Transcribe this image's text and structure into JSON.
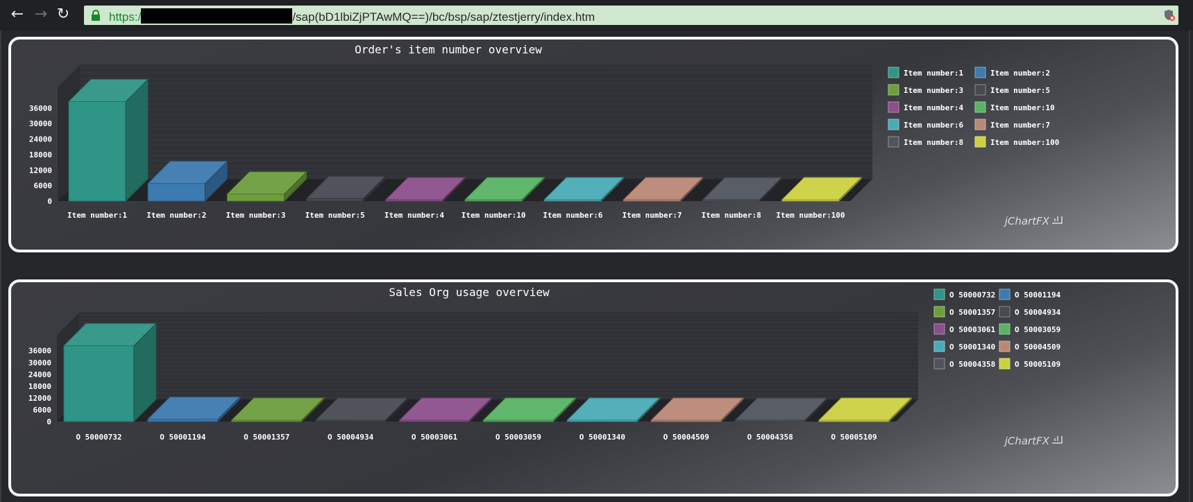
{
  "browser": {
    "url_scheme": "https:/",
    "url_path": "/sap(bD1lbiZjPTAwMQ==)/bc/bsp/sap/ztestjerry/index.htm",
    "back_icon": "arrow-left-icon",
    "forward_icon": "arrow-right-icon",
    "reload_icon": "reload-icon",
    "secure_icon": "lock-icon",
    "extension_icon": "shield-icon"
  },
  "colors": {
    "teal": "#2f9586",
    "blue": "#3d7ab0",
    "green": "#6d9e3d",
    "dark": "#474a52",
    "purple": "#8b4f8c",
    "lightgreen": "#59b363",
    "cyan": "#4aabb6",
    "salmon": "#b98876",
    "slate": "#4f545e",
    "yellow": "#ccd142"
  },
  "charts": [
    {
      "brand": "jChartFX",
      "chart_data": {
        "type": "bar",
        "title": "Order's item number overview",
        "categories": [
          "Item number:1",
          "Item number:2",
          "Item number:3",
          "Item number:5",
          "Item number:4",
          "Item number:10",
          "Item number:6",
          "Item number:7",
          "Item number:8",
          "Item number:100"
        ],
        "values": [
          38500,
          6800,
          2700,
          1000,
          200,
          150,
          100,
          80,
          60,
          30
        ],
        "colors": [
          "#2f9586",
          "#3d7ab0",
          "#6d9e3d",
          "#474a52",
          "#8b4f8c",
          "#59b363",
          "#4aabb6",
          "#b98876",
          "#4f545e",
          "#ccd142"
        ],
        "yticks": [
          "0",
          "6000",
          "12000",
          "18000",
          "24000",
          "30000",
          "36000"
        ],
        "ylim": [
          0,
          44000
        ],
        "xlabel": "",
        "ylabel": "",
        "legend": [
          "Item number:1",
          "Item number:2",
          "Item number:3",
          "Item number:5",
          "Item number:4",
          "Item number:10",
          "Item number:6",
          "Item number:7",
          "Item number:8",
          "Item number:100"
        ],
        "legend_position": "right",
        "grid": true
      }
    },
    {
      "brand": "jChartFX",
      "chart_data": {
        "type": "bar",
        "title": "Sales Org usage overview",
        "categories": [
          "O 50000732",
          "O 50001194",
          "O 50001357",
          "O 50004934",
          "O 50003061",
          "O 50003059",
          "O 50001340",
          "O 50004509",
          "O 50004358",
          "O 50005109"
        ],
        "values": [
          38500,
          1200,
          150,
          100,
          80,
          60,
          50,
          40,
          30,
          20
        ],
        "colors": [
          "#2f9586",
          "#3d7ab0",
          "#6d9e3d",
          "#474a52",
          "#8b4f8c",
          "#59b363",
          "#4aabb6",
          "#b98876",
          "#4f545e",
          "#ccd142"
        ],
        "yticks": [
          "0",
          "6000",
          "12000",
          "18000",
          "24000",
          "30000",
          "36000"
        ],
        "ylim": [
          0,
          44000
        ],
        "xlabel": "",
        "ylabel": "",
        "legend": [
          "O 50000732",
          "O 50001194",
          "O 50001357",
          "O 50004934",
          "O 50003061",
          "O 50003059",
          "O 50001340",
          "O 50004509",
          "O 50004358",
          "O 50005109"
        ],
        "legend_position": "right",
        "grid": true
      }
    }
  ]
}
